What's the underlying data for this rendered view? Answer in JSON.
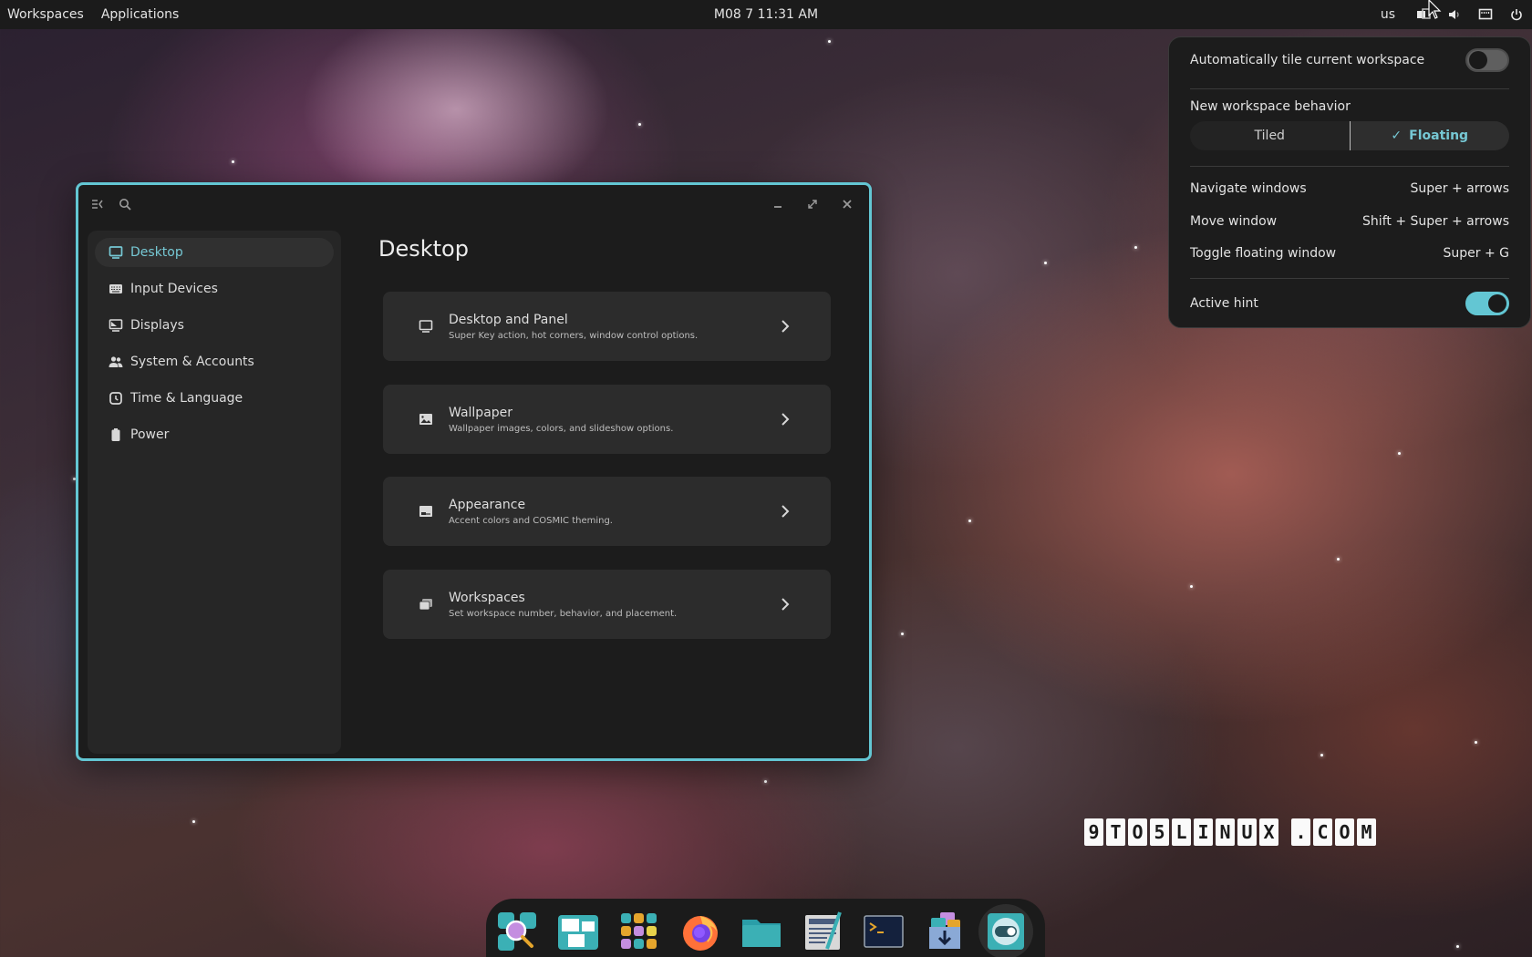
{
  "topbar": {
    "workspaces": "Workspaces",
    "applications": "Applications",
    "clock": "M08 7 11:31 AM",
    "keyboard_layout": "us",
    "tray_icons": [
      "tiling-icon",
      "volume-icon",
      "network-wired-icon",
      "power-icon"
    ]
  },
  "window": {
    "title_buttons": [
      "sidebar-toggle-icon",
      "search-icon",
      "minimize-icon",
      "maximize-icon",
      "close-icon"
    ],
    "sidebar": {
      "items": [
        {
          "label": "Desktop",
          "icon": "monitor-icon",
          "active": true
        },
        {
          "label": "Input Devices",
          "icon": "keyboard-icon",
          "active": false
        },
        {
          "label": "Displays",
          "icon": "display-icon",
          "active": false
        },
        {
          "label": "System & Accounts",
          "icon": "users-icon",
          "active": false
        },
        {
          "label": "Time & Language",
          "icon": "clock-icon",
          "active": false
        },
        {
          "label": "Power",
          "icon": "battery-icon",
          "active": false
        }
      ]
    },
    "page_title": "Desktop",
    "cards": [
      {
        "title": "Desktop and Panel",
        "subtitle": "Super Key action, hot corners, window control options.",
        "icon": "monitor-icon"
      },
      {
        "title": "Wallpaper",
        "subtitle": "Wallpaper images, colors, and slideshow options.",
        "icon": "image-icon"
      },
      {
        "title": "Appearance",
        "subtitle": "Accent colors and COSMIC theming.",
        "icon": "appearance-icon"
      },
      {
        "title": "Workspaces",
        "subtitle": "Set workspace number, behavior, and placement.",
        "icon": "workspaces-icon"
      }
    ]
  },
  "tiling_panel": {
    "auto_tile_label": "Automatically tile current workspace",
    "auto_tile_enabled": false,
    "new_workspace_label": "New workspace behavior",
    "options": [
      "Tiled",
      "Floating"
    ],
    "selected_option": "Floating",
    "shortcuts": [
      {
        "action": "Navigate windows",
        "keys": "Super + arrows"
      },
      {
        "action": "Move window",
        "keys": "Shift + Super + arrows"
      },
      {
        "action": "Toggle floating window",
        "keys": "Super + G"
      }
    ],
    "active_hint_label": "Active hint",
    "active_hint_enabled": true
  },
  "dock": {
    "apps": [
      "App Library Search",
      "Workspaces Overview",
      "App Library",
      "Firefox",
      "Files",
      "Text Editor",
      "Terminal",
      "Store",
      "Settings"
    ]
  },
  "watermark": [
    "9",
    "T",
    "O",
    "5",
    "L",
    "I",
    "N",
    "U",
    "X",
    " ",
    ".",
    "C",
    "O",
    "M"
  ],
  "colors": {
    "accent": "#63c6d3",
    "accent_text": "#76c8d4",
    "panel_bg": "#1c1c1c",
    "card_bg": "#2c2c2c"
  }
}
